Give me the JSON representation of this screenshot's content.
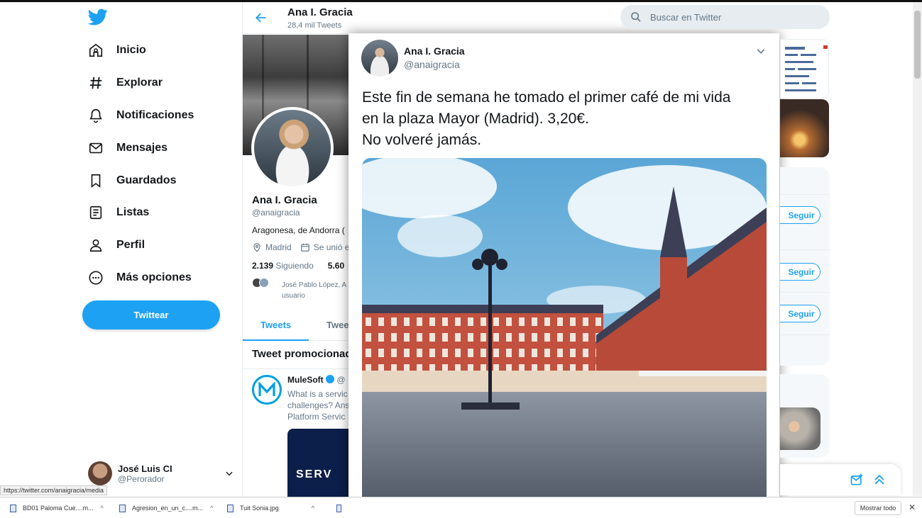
{
  "nav": {
    "items": [
      {
        "label": "Inicio",
        "icon": "home-icon"
      },
      {
        "label": "Explorar",
        "icon": "hashtag-icon"
      },
      {
        "label": "Notificaciones",
        "icon": "bell-icon"
      },
      {
        "label": "Mensajes",
        "icon": "envelope-icon"
      },
      {
        "label": "Guardados",
        "icon": "bookmark-icon"
      },
      {
        "label": "Listas",
        "icon": "list-icon"
      },
      {
        "label": "Perfil",
        "icon": "person-icon"
      },
      {
        "label": "Más opciones",
        "icon": "more-icon"
      }
    ],
    "tweet_button": "Twittear"
  },
  "account": {
    "name": "José Luis CI",
    "handle": "@Perorador"
  },
  "profile_header": {
    "name": "Ana I. Gracia",
    "tweet_count": "28,4 mil Tweets"
  },
  "profile": {
    "name": "Ana I. Gracia",
    "handle": "@anaigracia",
    "bio": "Aragonesa, de Andorra (",
    "location": "Madrid",
    "joined": "Se unió e",
    "following_count": "2.139",
    "following_label": "Siguiendo",
    "followers_count": "5.60",
    "followed_by_line1": "José Pablo López, A",
    "followed_by_line2": "usuario",
    "tabs": [
      "Tweets",
      "Twee"
    ],
    "promo_title": "Tweet promocionad",
    "promo": {
      "name": "MuleSoft",
      "handle": "@",
      "text": [
        "What is a servic",
        "challenges? Ans",
        "Platform Servic"
      ],
      "card_text": "SERV"
    }
  },
  "tweet": {
    "name": "Ana I. Gracia",
    "handle": "@anaigracia",
    "text_lines": [
      "Este fin de semana he tomado el primer café de mi vida",
      "en la plaza Mayor (Madrid). 3,20€.",
      "No volveré jamás."
    ]
  },
  "search": {
    "placeholder": "Buscar en Twitter"
  },
  "right": {
    "follow_label": "Seguir"
  },
  "status_url": "https://twitter.com/anaigracia/media",
  "downloads": {
    "items": [
      "BD01 Paloma Cue....m...",
      "Agresion_en_un_c....m...",
      "Tuit Sonia.jpg"
    ],
    "show_all": "Mostrar todo"
  },
  "colors": {
    "accent": "#1da1f2",
    "text": "#14171a",
    "muted": "#657786",
    "border": "#e6ecf0"
  }
}
